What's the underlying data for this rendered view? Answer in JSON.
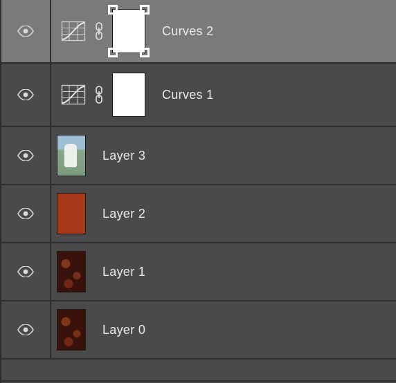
{
  "layers": [
    {
      "name": "Curves 2",
      "type": "adjustment",
      "adjustment": "curves",
      "visible": true,
      "selected": true,
      "mask": "white",
      "mask_selected": true
    },
    {
      "name": "Curves 1",
      "type": "adjustment",
      "adjustment": "curves",
      "visible": true,
      "selected": false,
      "mask": "white",
      "mask_selected": false
    },
    {
      "name": "Layer 3",
      "type": "pixel",
      "visible": true,
      "thumb_style": "photo"
    },
    {
      "name": "Layer 2",
      "type": "pixel",
      "visible": true,
      "thumb_style": "solid",
      "thumb_color": "#a8371a"
    },
    {
      "name": "Layer 1",
      "type": "pixel",
      "visible": true,
      "thumb_style": "texture"
    },
    {
      "name": "Layer 0",
      "type": "pixel",
      "visible": true,
      "thumb_style": "texture"
    }
  ],
  "icons": {
    "eye": "eye-icon",
    "curves": "curves-adjustment-icon",
    "link": "link-icon"
  }
}
